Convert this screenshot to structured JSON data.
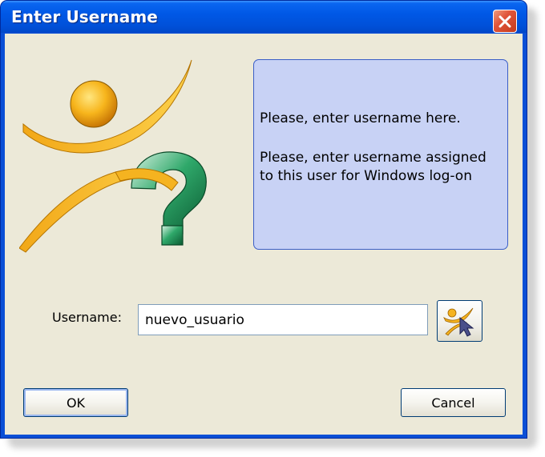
{
  "window": {
    "title": "Enter Username",
    "close_icon": "close-icon"
  },
  "info": {
    "line1": "Please, enter username here.",
    "line2": "Please, enter username assigned to this user for Windows log-on"
  },
  "form": {
    "username_label": "Username:",
    "username_value": "nuevo_usuario",
    "browse_icon": "user-pick-icon"
  },
  "buttons": {
    "ok": "OK",
    "cancel": "Cancel"
  },
  "colors": {
    "title_bar": "#0054e3",
    "client_bg": "#ece9d8",
    "info_bg": "#c8d2f5",
    "info_border": "#3a5ec7",
    "close_button": "#e0553a"
  }
}
